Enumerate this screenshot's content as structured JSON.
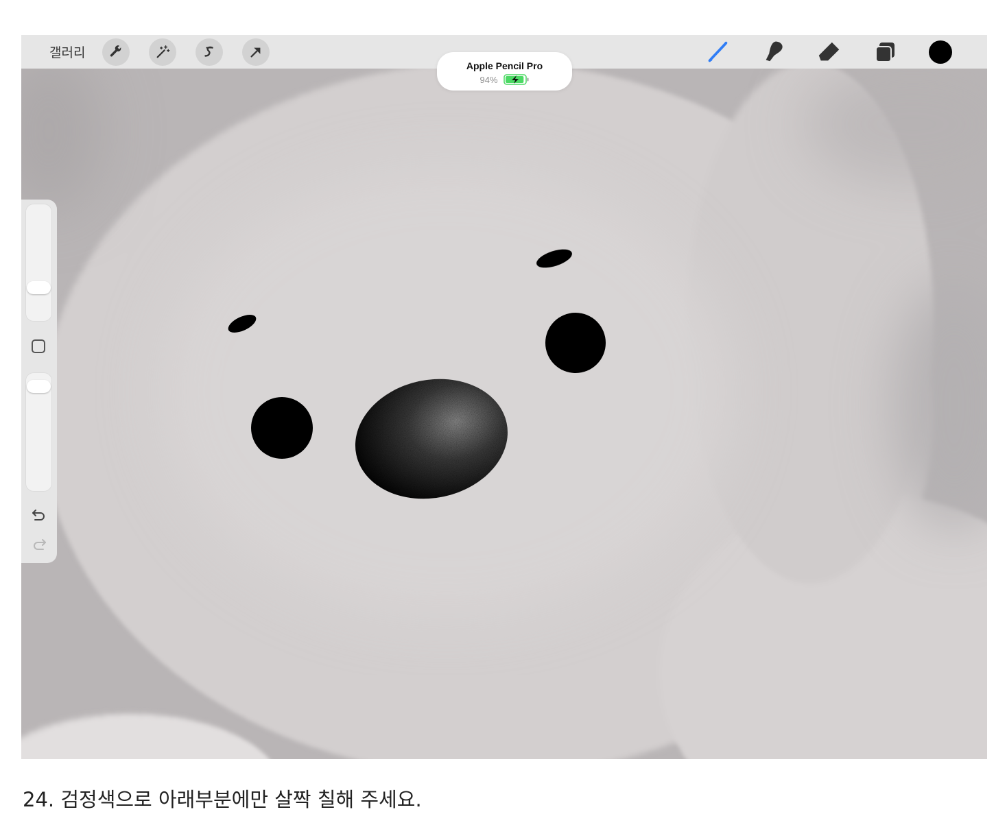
{
  "app": {
    "gallery_label": "갤러리",
    "toolbar_left": [
      {
        "icon": "wrench-icon",
        "name": "actions-button"
      },
      {
        "icon": "magic-wand-icon",
        "name": "adjustments-button"
      },
      {
        "icon": "selection-s-icon",
        "name": "selection-button"
      },
      {
        "icon": "arrow-cursor-icon",
        "name": "transform-button"
      }
    ],
    "toolbar_right": [
      {
        "icon": "brush-icon",
        "name": "brush-tool-button",
        "active": true
      },
      {
        "icon": "smudge-icon",
        "name": "smudge-tool-button"
      },
      {
        "icon": "eraser-icon",
        "name": "eraser-tool-button"
      },
      {
        "icon": "layers-icon",
        "name": "layers-button"
      },
      {
        "icon": "color-swatch-icon",
        "name": "color-button"
      }
    ],
    "active_color": "#000000",
    "accent_color": "#2f7df6"
  },
  "pencil_hud": {
    "device_name": "Apple Pencil Pro",
    "battery_percent": "94%",
    "battery_level": 0.94,
    "battery_color": "#4cd964"
  },
  "sidebar": {
    "brush_size_level": 0.25,
    "opacity_level": 0.95,
    "undo_icon": "undo-icon",
    "redo_icon": "redo-icon"
  },
  "caption": "24. 검정색으로 아래부분에만 살짝 칠해 주세요."
}
